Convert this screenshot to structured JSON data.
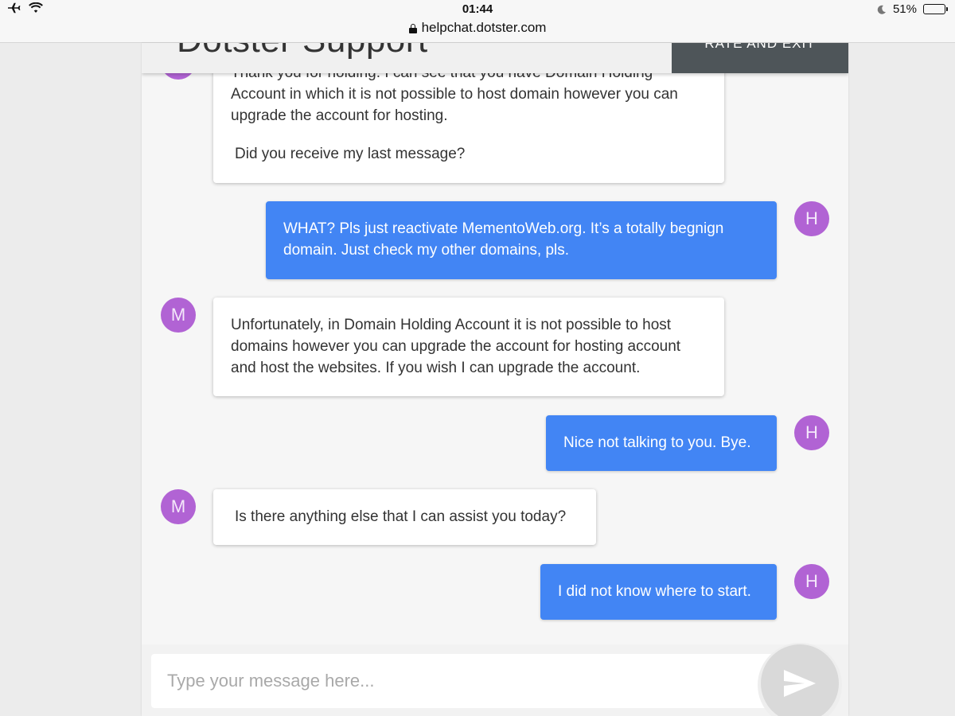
{
  "status_bar": {
    "time": "01:44",
    "battery": "51%",
    "battery_level": 0.51
  },
  "browser": {
    "url": "helpchat.dotster.com"
  },
  "header": {
    "title": "Dotster Support",
    "rate_exit_label": "RATE AND EXIT"
  },
  "messages": [
    {
      "sender": "agent",
      "avatar": "M",
      "paragraphs": [
        "Thank you for holding. I can see that you have Domain Holding Account in which it is not possible to host domain however you can upgrade the account for hosting.",
        "Did you receive my last message?"
      ]
    },
    {
      "sender": "user",
      "avatar": "H",
      "text": "WHAT? Pls just reactivate MementoWeb.org. It’s a totally begnign domain. Just check my other domains, pls."
    },
    {
      "sender": "agent",
      "avatar": "M",
      "text": "Unfortunately, in Domain Holding Account it is not possible to host domains however you can upgrade the account for hosting account and host the websites. If you wish I can upgrade the account."
    },
    {
      "sender": "user",
      "avatar": "H",
      "text": "Nice not talking to you. Bye."
    },
    {
      "sender": "agent",
      "avatar": "M",
      "text": "Is there anything else that I can assist you today?"
    },
    {
      "sender": "user",
      "avatar": "H",
      "text": "I did not know where to start."
    }
  ],
  "composer": {
    "placeholder": "Type your message here..."
  },
  "colors": {
    "user_bubble": "#4285f4",
    "avatar": "#b163d4",
    "header_button": "#4e5559"
  }
}
